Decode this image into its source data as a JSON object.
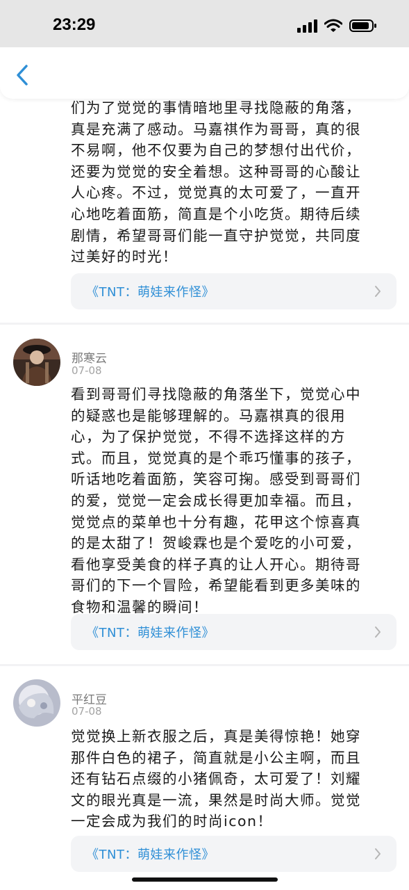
{
  "status_bar": {
    "time": "23:29"
  },
  "comments": [
    {
      "text": "们为了觉觉的事情暗地里寻找隐蔽的角落，\n真是充满了感动。马嘉祺作为哥哥，真的很\n不易啊，他不仅要为自己的梦想付出代价，\n还要为觉觉的安全着想。这种哥哥的心酸让\n人心疼。不过，觉觉真的太可爱了，一直开\n心地吃着面筋，简直是个小吃货。期待后续\n剧情，希望哥哥们能一直守护觉觉，共同度\n过美好的时光！",
      "show_link": "《TNT：萌娃来作怪》"
    },
    {
      "username": "那寒云",
      "date": "07-08",
      "avatar_icon": "user-avatar-icon",
      "text": "看到哥哥们寻找隐蔽的角落坐下，觉觉心中\n的疑惑也是能够理解的。马嘉祺真的很用\n心，为了保护觉觉，不得不选择这样的方\n式。而且，觉觉真的是个乖巧懂事的孩子，\n听话地吃着面筋，笑容可掬。感受到哥哥们\n的爱，觉觉一定会成长得更加幸福。而且，\n觉觉点的菜单也十分有趣，花甲这个惊喜真\n的是太甜了！贺峻霖也是个爱吃的小可爱，\n看他享受美食的样子真的让人开心。期待哥\n哥们的下一个冒险，希望能看到更多美味的\n食物和温馨的瞬间！",
      "show_link": "《TNT：萌娃来作怪》"
    },
    {
      "username": "平红豆",
      "date": "07-08",
      "avatar_icon": "user-avatar-icon",
      "text": "觉觉换上新衣服之后，真是美得惊艳！她穿\n那件白色的裙子，简直就是小公主啊，而且\n还有钻石点缀的小猪佩奇，太可爱了！刘耀\n文的眼光真是一流，果然是时尚大师。觉觉\n一定会成为我们的时尚icon！",
      "show_link": "《TNT：萌娃来作怪》"
    }
  ],
  "icons": [
    "back-arrow-icon",
    "chevron-right-icon",
    "signal-icon",
    "wifi-icon",
    "battery-icon"
  ],
  "colors": {
    "link": "#2f8fd6",
    "back_arrow": "#2f8fd6",
    "background": "#f2f2f4"
  }
}
